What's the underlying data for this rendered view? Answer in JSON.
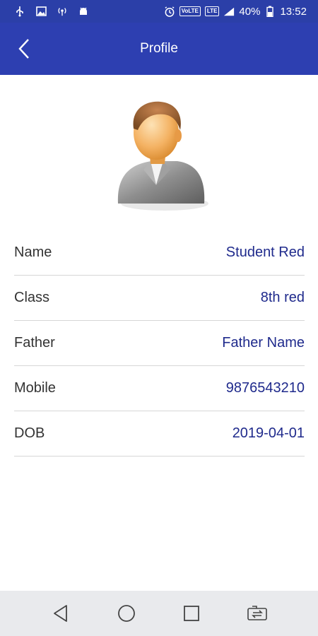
{
  "status_bar": {
    "volte_label": "VoLTE",
    "lte_label": "LTE",
    "battery_percent": "40%",
    "time": "13:52",
    "icons": [
      "usb-icon",
      "image-icon",
      "hotspot-icon",
      "android-debug-icon",
      "alarm-icon",
      "volte-icon",
      "lte-icon",
      "signal-icon",
      "battery-icon"
    ]
  },
  "app_bar": {
    "title": "Profile",
    "back_icon": "chevron-left-icon"
  },
  "profile": {
    "avatar_icon": "user-avatar-icon",
    "fields": [
      {
        "label": "Name",
        "value": "Student Red"
      },
      {
        "label": "Class",
        "value": "8th red"
      },
      {
        "label": "Father",
        "value": "Father Name"
      },
      {
        "label": "Mobile",
        "value": "9876543210"
      },
      {
        "label": "DOB",
        "value": "2019-04-01"
      }
    ]
  },
  "nav_bar": {
    "icons": [
      "back-triangle-icon",
      "home-circle-icon",
      "recents-square-icon",
      "switch-sim-icon"
    ]
  },
  "colors": {
    "primary": "#2d3fb1",
    "value_text": "#1f2a8c",
    "label_text": "#333333",
    "divider": "#d6d6d6",
    "nav_bg": "#e9eaed"
  }
}
